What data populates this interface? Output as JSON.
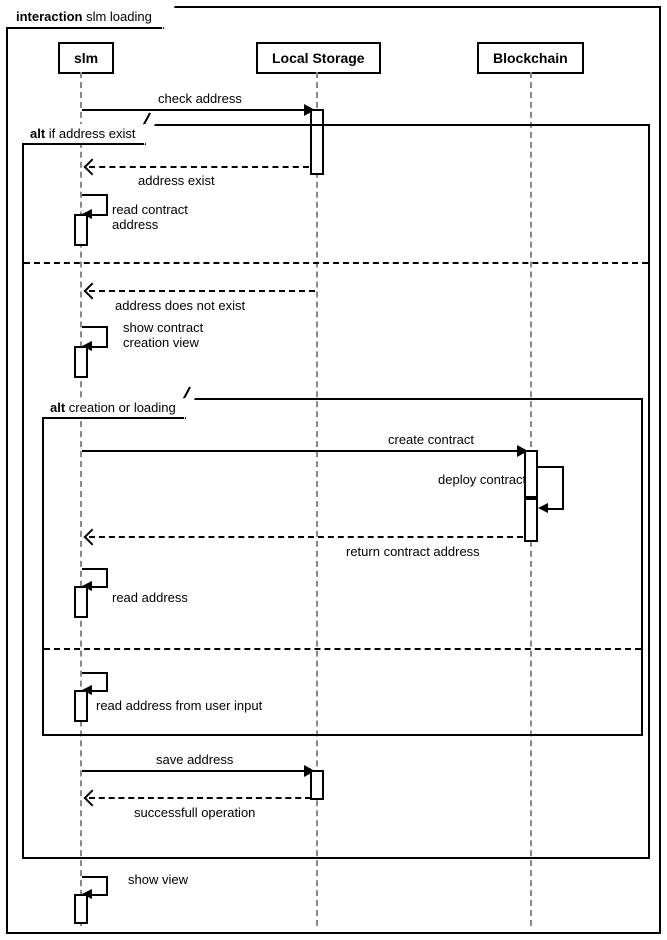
{
  "frame": {
    "label_bold": "interaction",
    "label_rest": " slm loading"
  },
  "participants": {
    "p1": "slm",
    "p2": "Local Storage",
    "p3": "Blockchain"
  },
  "messages": {
    "m1": "check address",
    "m2": "address exist",
    "m3": "read contract\naddress",
    "m4": "address does not exist",
    "m5": "show contract\ncreation view",
    "m6": "create contract",
    "m7": "deploy contract",
    "m8": "return contract address",
    "m9": "read address",
    "m10": "read address from user input",
    "m11": "save address",
    "m12": "successfull operation",
    "m13": "show view"
  },
  "fragments": {
    "alt1": {
      "kw": "alt",
      "guard": " if address exist"
    },
    "alt2": {
      "kw": "alt",
      "guard": " creation or loading"
    }
  }
}
